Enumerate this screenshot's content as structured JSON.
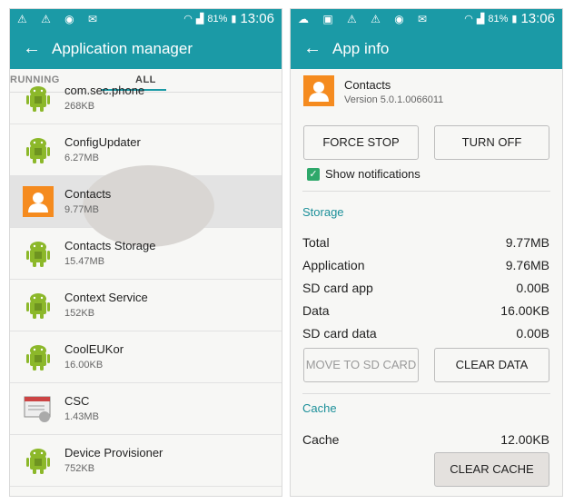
{
  "left_panel": {
    "status": {
      "icons": "⚠ ⚠ ◉ ✉",
      "battery": "81%",
      "time": "13:06"
    },
    "title": "Application manager",
    "tabs": [
      "RUNNING",
      "ALL"
    ],
    "apps": [
      {
        "name": "com.sec.phone",
        "size": "268KB",
        "icon": "android-icon"
      },
      {
        "name": "ConfigUpdater",
        "size": "6.27MB",
        "icon": "android-icon"
      },
      {
        "name": "Contacts",
        "size": "9.77MB",
        "icon": "contacts-icon",
        "selected": true
      },
      {
        "name": "Contacts Storage",
        "size": "15.47MB",
        "icon": "android-icon"
      },
      {
        "name": "Context Service",
        "size": "152KB",
        "icon": "android-icon"
      },
      {
        "name": "CoolEUKor",
        "size": "16.00KB",
        "icon": "android-icon"
      },
      {
        "name": "CSC",
        "size": "1.43MB",
        "icon": "csc-icon"
      },
      {
        "name": "Device Provisioner",
        "size": "752KB",
        "icon": "android-icon"
      }
    ]
  },
  "right_panel": {
    "status": {
      "icons": "☁ ▣ ⚠ ⚠ ◉ ✉",
      "battery": "81%",
      "time": "13:06"
    },
    "title": "App info",
    "app": {
      "name": "Contacts",
      "version": "Version 5.0.1.0066011"
    },
    "buttons": {
      "force_stop": "FORCE STOP",
      "turn_off": "TURN OFF",
      "move_sd": "MOVE TO SD CARD",
      "clear_data": "CLEAR DATA",
      "clear_cache": "CLEAR CACHE"
    },
    "show_notifications": "Show notifications",
    "storage_heading": "Storage",
    "storage": [
      {
        "label": "Total",
        "value": "9.77MB"
      },
      {
        "label": "Application",
        "value": "9.76MB"
      },
      {
        "label": "SD card app",
        "value": "0.00B"
      },
      {
        "label": "Data",
        "value": "16.00KB"
      },
      {
        "label": "SD card data",
        "value": "0.00B"
      }
    ],
    "cache_heading": "Cache",
    "cache": {
      "label": "Cache",
      "value": "12.00KB"
    }
  },
  "colors": {
    "accent": "#1b9aa6",
    "contacts_orange": "#f58b1f",
    "android_green": "#8cb82a"
  }
}
